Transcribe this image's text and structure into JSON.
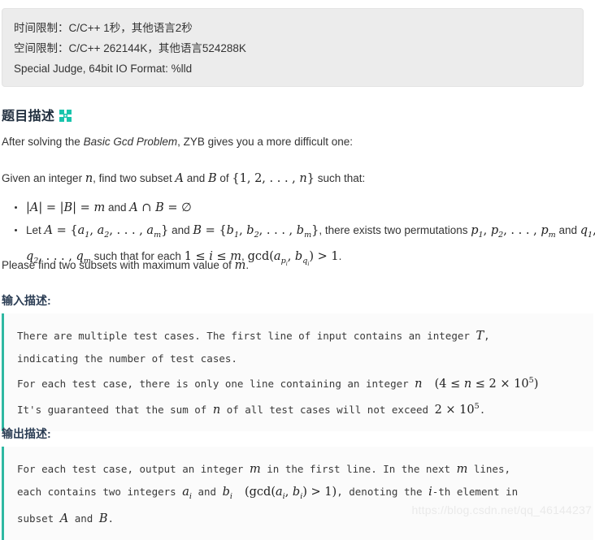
{
  "limits": {
    "time_limit": "时间限制：C/C++ 1秒，其他语言2秒",
    "memory_limit": "空间限制：C/C++ 262144K，其他语言524288K",
    "judge_info": "Special Judge, 64bit IO Format: %lld"
  },
  "description": {
    "heading": "题目描述",
    "heading_icon": "tiles-icon",
    "intro_before": "After solving the ",
    "intro_italic": "Basic Gcd Problem",
    "intro_after": ", ZYB gives you a more difficult one:",
    "given_text": "Given an integer n, find two subset A and B of {1, 2, … , n} such that:",
    "bullets": [
      "|A| = |B| = m and A ∩ B = ∅",
      "Let A = {a1, a2, … , am} and B = {b1, b2, … , bm}, there exists two permutations p1, p2, … , pm and q1, q2, … , qm such that for each 1 ≤ i ≤ m, gcd(api, bqi) > 1."
    ],
    "closing": "Please find two subsets with maximum value of m."
  },
  "input_section": {
    "heading": "输入描述:",
    "lines": [
      "There are multiple test cases. The first line of input contains an integer T,",
      "indicating the number of test cases.",
      "For each test case, there is only one line containing an integer n  (4 ≤ n ≤ 2 × 10^5)",
      "It's guaranteed that the sum of n of all test cases will not exceed 2 × 10^5."
    ]
  },
  "output_section": {
    "heading": "输出描述:",
    "lines": [
      "For each test case, output an integer m in the first line. In the next m lines,",
      "each contains two integers ai and bi  (gcd(ai, bi) > 1), denoting the i-th element in",
      "subset A and B."
    ]
  },
  "watermark": {
    "text": "https://blog.csdn.net/qq_46144237"
  },
  "colors": {
    "panel_bg": "#ececec",
    "accent_teal": "#2fb8a2",
    "heading_navy": "#1f2d3d",
    "code_bg": "#fbfbfb"
  }
}
